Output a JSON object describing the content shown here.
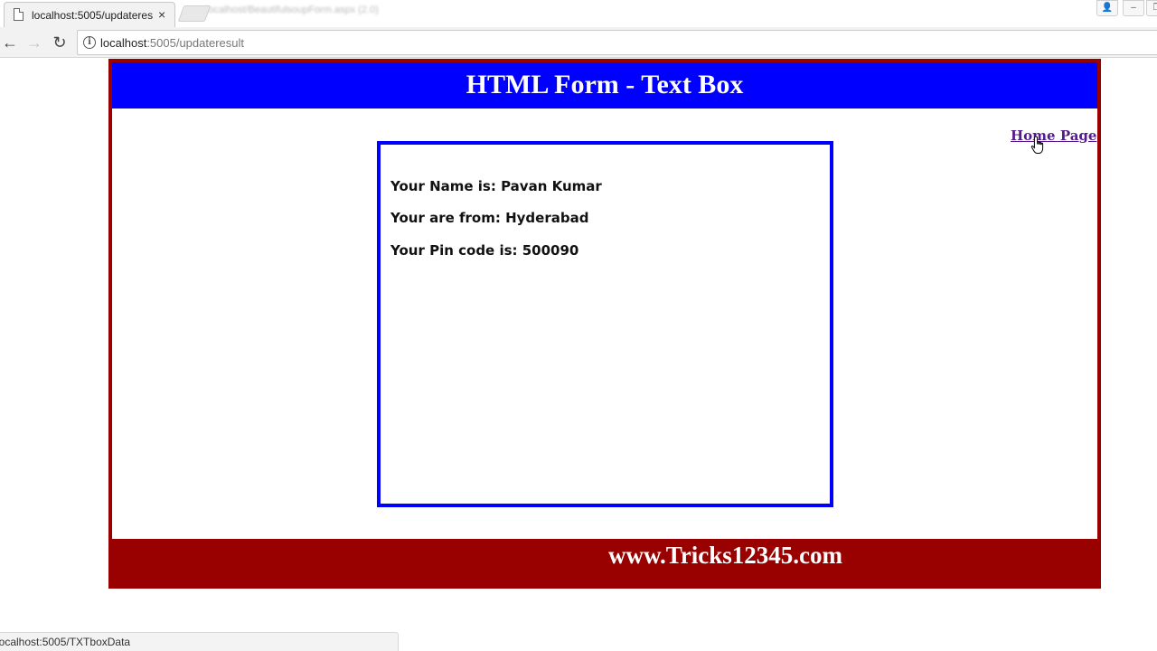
{
  "browser": {
    "tab_title": "localhost:5005/updateres",
    "tab_close": "×",
    "inactive_tab_title": "localhost/BeautifulsoupForm.aspx (2.0)",
    "url_host": "localhost",
    "url_rest": ":5005/updateresult",
    "status_url": "localhost:5005/TXTboxData",
    "nav": {
      "back": "←",
      "forward": "→",
      "reload": "↻",
      "info": "i"
    },
    "window_buttons": {
      "user": "👤",
      "minimize": "–",
      "restore": "❐"
    }
  },
  "page": {
    "header_title": "HTML Form - Text Box",
    "home_link": "Home Page",
    "result": {
      "name_line": "Your Name is: Pavan Kumar",
      "from_line": "Your are from: Hyderabad",
      "pin_line": "Your Pin code is: 500090"
    },
    "footer_text": "www.Tricks12345.com"
  },
  "colors": {
    "header_bg": "#0000ff",
    "frame_border": "#990000",
    "footer_bg": "#990000",
    "result_border": "#0000ff",
    "link": "#551a8b"
  }
}
